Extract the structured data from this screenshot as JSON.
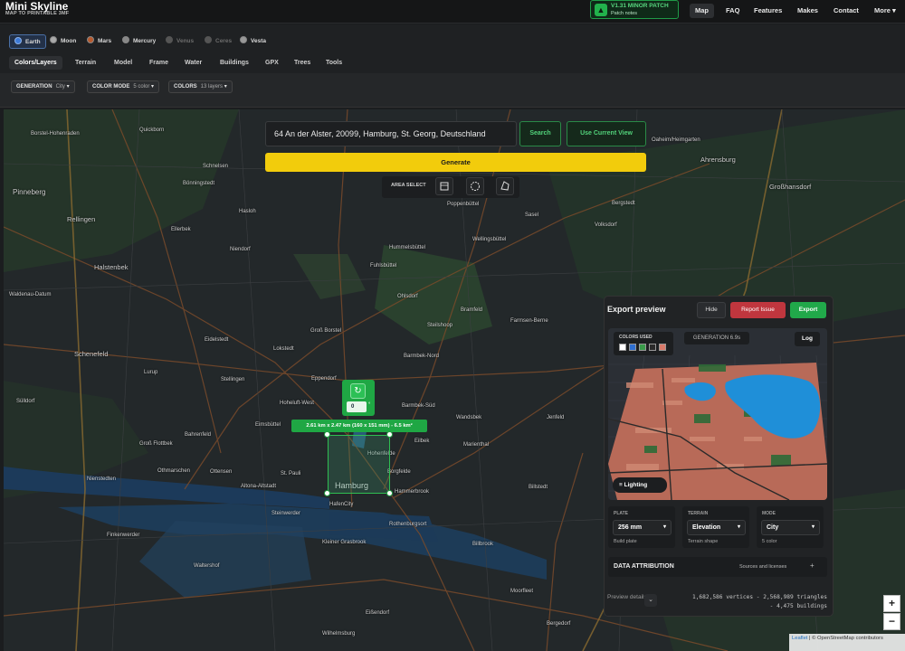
{
  "header": {
    "title": "Mini Skyline",
    "subtitle": "MAP TO PRINTABLE 3MF",
    "patch": {
      "title": "V1.31 MINOR PATCH",
      "sub": "Patch notes"
    },
    "nav": [
      "Map",
      "FAQ",
      "Features",
      "Makes",
      "Contact",
      "More"
    ]
  },
  "planets": [
    {
      "label": "Earth",
      "active": true
    },
    {
      "label": "Moon"
    },
    {
      "label": "Mars"
    },
    {
      "label": "Mercury"
    },
    {
      "label": "Venus",
      "disabled": true
    },
    {
      "label": "Ceres",
      "disabled": true
    },
    {
      "label": "Vesta"
    }
  ],
  "tabs": [
    "Colors/Layers",
    "Terrain",
    "Model",
    "Frame",
    "Water",
    "Buildings",
    "GPX",
    "Trees",
    "Tools"
  ],
  "options": [
    {
      "label": "GENERATION",
      "value": "City"
    },
    {
      "label": "COLOR MODE",
      "value": "5 color"
    },
    {
      "label": "COLORS",
      "value": "13 layers"
    }
  ],
  "search": {
    "value": "64 An der Alster, 20099, Hamburg, St. Georg, Deutschland",
    "search_label": "Search",
    "use_current_label": "Use Current View",
    "generate_label": "Generate",
    "area_select_label": "AREA SELECT"
  },
  "selection": {
    "dimensions": "2.61 km x 2.47 km (160 x 151 mm) - 6.5 km²",
    "rotation": "0",
    "rotation_unit": "°"
  },
  "map_labels": [
    "Borstel-Hohenraden",
    "Pinneberg",
    "Rellingen",
    "Halstenbek",
    "Waldenau-Datum",
    "Schenefeld",
    "Sülldorf",
    "Nienstedten",
    "Finkenwerder",
    "Waltershof",
    "Hamburg",
    "Altona-Altstadt",
    "St. Pauli",
    "Ottensen",
    "Othmarschen",
    "Groß Flottbek",
    "Bahrenfeld",
    "Eimsbüttel",
    "Hoheluft-West",
    "Lokstedt",
    "Eppendorf",
    "Groß Borstel",
    "Barmbek-Nord",
    "Barmbek-Süd",
    "Wandsbek",
    "Eilbek",
    "Hohenfelde",
    "Borgfelde",
    "Hammerbrook",
    "Rothenburgsort",
    "Kleiner Grasbrook",
    "Wilhelmsburg",
    "Steinwerder",
    "HafenCity",
    "Poppenbüttel",
    "Wellingsbüttel",
    "Hummelsbüttel",
    "Fuhlsbüttel",
    "Ohlsdorf",
    "Bramfeld",
    "Steilshoop",
    "Farmsen-Berne",
    "Sasel",
    "Volksdorf",
    "Ahrensburg",
    "Großhansdorf",
    "Oaheim/Heimgarten",
    "Bergstedt",
    "Billstedt",
    "Billbrook",
    "Marienthal",
    "Jenfeld",
    "Schnelsen",
    "Niendorf",
    "Lurup",
    "Eidelstedt",
    "Stellingen",
    "Bergedorf",
    "Eißendorf",
    "Bönningstedt",
    "Ellerbek",
    "Quickborn",
    "Hasloh",
    "Moorfleet"
  ],
  "export": {
    "title": "Export preview",
    "hide_label": "Hide",
    "report_label": "Report Issue",
    "export_label": "Export",
    "colors_used_label": "COLORS USED",
    "colors_used": [
      "#ffffff",
      "#2f6fd1",
      "#3a9b4a",
      "#2b2b2b",
      "#d97a6a"
    ],
    "generation_time": "GENERATION 6.9s",
    "log_label": "Log",
    "lighting_label": "Lighting",
    "plate": {
      "label": "PLATE",
      "value": "256 mm",
      "sub": "Build plate"
    },
    "terrain": {
      "label": "TERRAIN",
      "value": "Elevation",
      "sub": "Terrain shape"
    },
    "mode": {
      "label": "MODE",
      "value": "City",
      "sub": "5 color"
    },
    "attribution_title": "DATA ATTRIBUTION",
    "attribution_link": "Sources and licenses",
    "preview_details_label": "Preview details",
    "stats_line1": "1,682,586 vertices - 2,568,989 triangles",
    "stats_line2": "- 4,475 buildings"
  },
  "zoom": {
    "in": "+",
    "out": "−"
  },
  "attribution": {
    "leaflet": "Leaflet",
    "rest": "| © OpenStreetMap contributors"
  }
}
